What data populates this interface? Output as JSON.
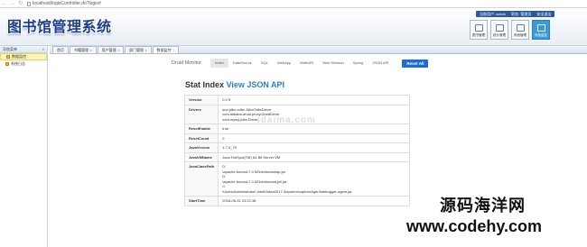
{
  "browser": {
    "url": "localhost/logisController.do?login#"
  },
  "header": {
    "app_title": "图书馆管理系统",
    "user_info": [
      "当前用户: admin",
      "职务: 管理员",
      "安全退出"
    ],
    "tiles": [
      {
        "label": "图书管理",
        "icon": "book-icon"
      },
      {
        "label": "统计管理",
        "icon": "chart-icon"
      },
      {
        "label": "系统管理",
        "icon": "settings-icon"
      },
      {
        "label": "系统监控",
        "icon": "monitor-icon"
      }
    ]
  },
  "sidebar": {
    "title": "导航菜单",
    "items": [
      "数据监控",
      "系统日志"
    ]
  },
  "tabs": [
    "首页",
    "书籍管理",
    "用户管理",
    "部门管理",
    "数据监控"
  ],
  "druid": {
    "brand": "Druid Monitor",
    "links": [
      "Index",
      "DataSource",
      "SQL",
      "WebApp",
      "WebURI",
      "Web Session",
      "Spring",
      "JSON API"
    ],
    "reset_label": "Reset All"
  },
  "stat": {
    "title": "Stat Index",
    "json_link": "View JSON API",
    "rows": [
      {
        "key": "Version",
        "value": [
          "0.2.9"
        ]
      },
      {
        "key": "Drivers",
        "value": [
          "sun.jdbc.odbc.JdbcOdbcDriver",
          "com.alibaba.druid.proxy.DruidDriver",
          "com.mysql.jdbc.Driver"
        ]
      },
      {
        "key": "ResetEnable",
        "value": [
          "true"
        ]
      },
      {
        "key": "ResetCount",
        "value": [
          "0"
        ]
      },
      {
        "key": "JavaVersion",
        "value": [
          "1.7.0_79"
        ]
      },
      {
        "key": "JavaVMName",
        "value": [
          "Java HotSpot(TM) 64-Bit Server VM"
        ]
      },
      {
        "key": "JavaClassPath",
        "value": [
          "D:",
          "\\apache-tomcat-7.0.52\\bin\\bootstrap.jar",
          "D:",
          "\\apache-tomcat-7.0.52\\bin\\tomcat-juli.jar",
          "C:",
          "\\Users\\Administrator\\.IntelliJIdea2017.3\\system\\captureAgent\\debugger-agent.jar"
        ]
      },
      {
        "key": "StartTime",
        "value": [
          "2018-05-31 23:22:38"
        ]
      }
    ]
  },
  "watermark": {
    "mid": "idaima.com",
    "cn": "源码海洋网",
    "url": "www.codehy.com"
  }
}
